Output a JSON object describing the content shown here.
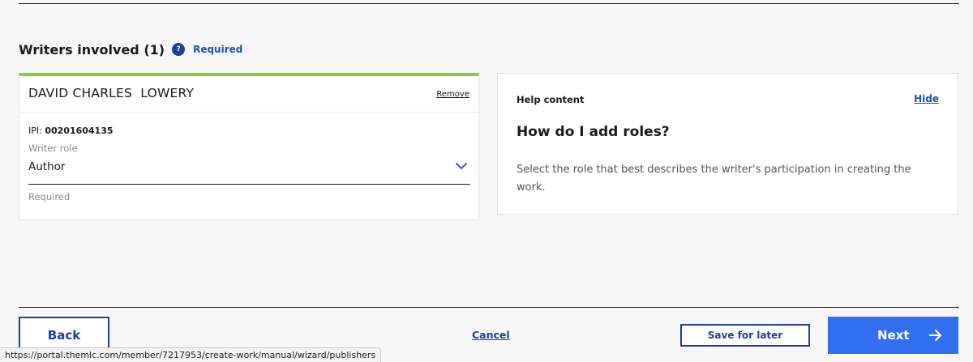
{
  "section": {
    "title": "Writers involved (1)",
    "help_badge": "?",
    "required_label": "Required"
  },
  "writer": {
    "name": "DAVID CHARLES  LOWERY",
    "remove_label": "Remove",
    "ipi_label": "IPI: ",
    "ipi_value": "00201604135",
    "role_label": "Writer role",
    "role_value": "Author",
    "role_helper": "Required"
  },
  "help": {
    "title": "Help content",
    "hide_label": "Hide",
    "question": "How do I add roles?",
    "answer": "Select the role that best describes the writer's participation in creating the work."
  },
  "footer": {
    "back_label": "Back",
    "cancel_label": "Cancel",
    "save_label": "Save for later",
    "next_label": "Next"
  },
  "status_bar": {
    "url": "https://portal.themlc.com/member/7217953/create-work/manual/wizard/publishers"
  },
  "colors": {
    "accent_green": "#7fd12d",
    "primary_blue": "#2f6ff0",
    "dark_blue": "#1e3f96",
    "link_blue": "#1e4fb0"
  }
}
